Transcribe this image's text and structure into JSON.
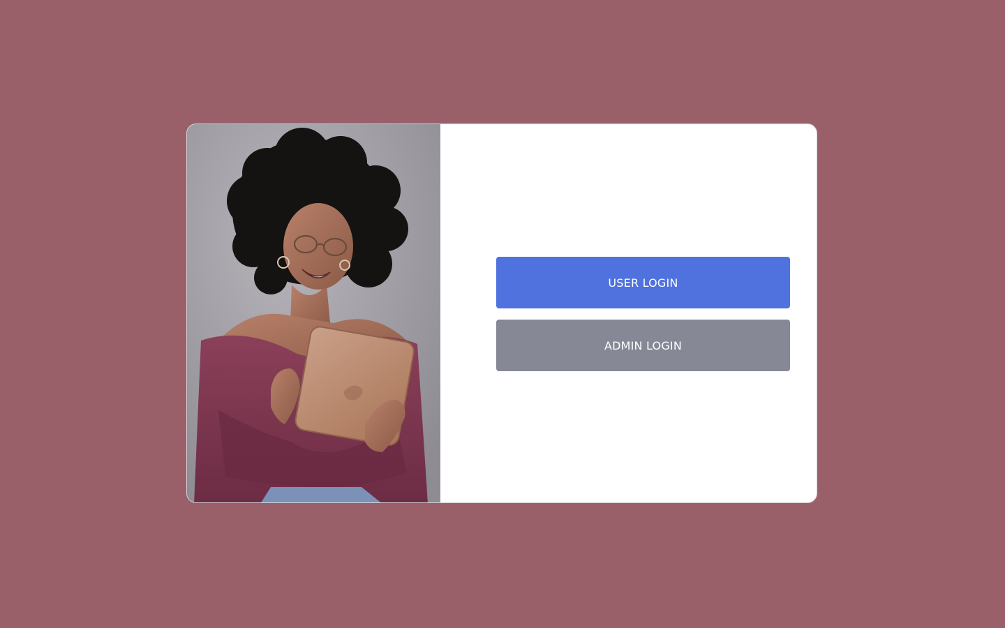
{
  "page": {
    "background_color": "#9a606a"
  },
  "login": {
    "user_button": {
      "label": "USER LOGIN",
      "color": "#5072de"
    },
    "admin_button": {
      "label": "ADMIN LOGIN",
      "color": "#868896"
    }
  },
  "image": {
    "subject": "woman-holding-tablet-photo",
    "sweater_color": "#7c3650",
    "tablet_color": "#b98568",
    "wall_color": "#a6a3aa"
  }
}
